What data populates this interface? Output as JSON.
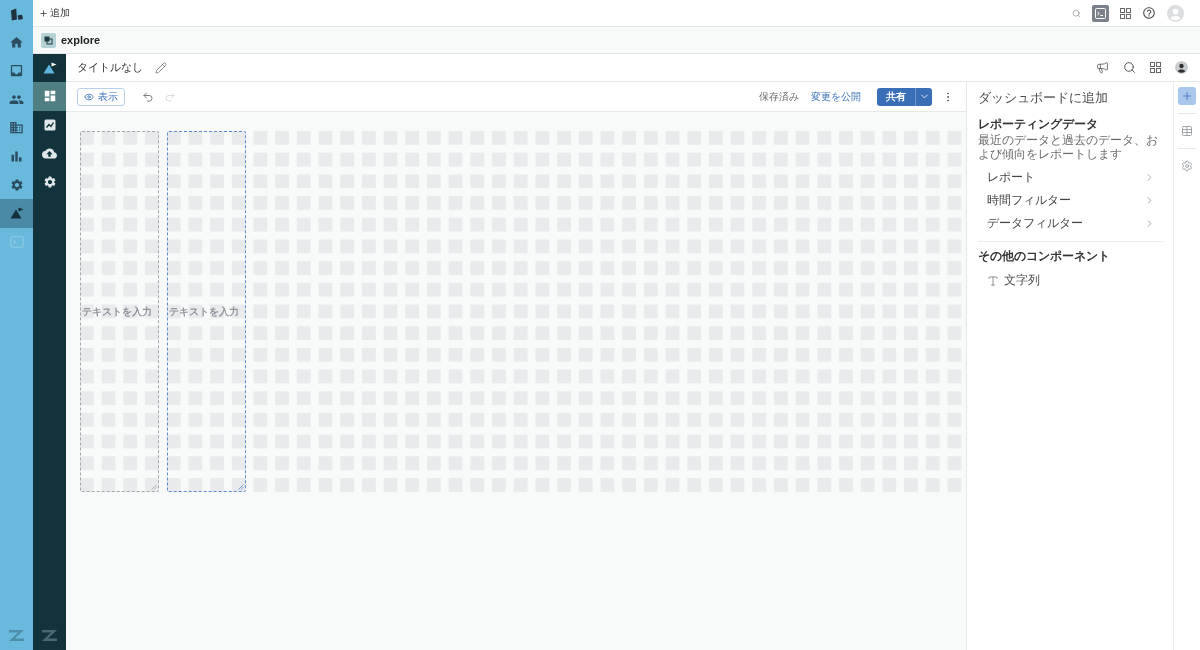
{
  "main_nav": {
    "items": [
      {
        "selected": false,
        "disabled": false
      },
      {
        "selected": false,
        "disabled": false
      },
      {
        "selected": false,
        "disabled": false
      },
      {
        "selected": false,
        "disabled": false
      },
      {
        "selected": false,
        "disabled": false
      },
      {
        "selected": false,
        "disabled": false
      },
      {
        "selected": true,
        "disabled": false
      },
      {
        "selected": false,
        "disabled": true
      }
    ]
  },
  "top_bar": {
    "add_button": "追加"
  },
  "app_header": {
    "name": "explore"
  },
  "explore_nav": {
    "items": [
      {
        "selected": true
      },
      {
        "selected": false
      },
      {
        "selected": false
      },
      {
        "selected": false
      }
    ]
  },
  "title_bar": {
    "title": "タイトルなし"
  },
  "toolbar": {
    "view_button": "表示",
    "undo": {
      "disabled": false
    },
    "redo": {
      "disabled": true
    },
    "save_status": "保存済み",
    "publish_link": "変更を公開",
    "share_button": "共有"
  },
  "canvas": {
    "widgets": [
      {
        "placeholder": "テキストを入力",
        "selected": false
      },
      {
        "placeholder": "テキストを入力",
        "selected": true
      }
    ]
  },
  "add_panel": {
    "title": "ダッシュボードに追加",
    "sections": [
      {
        "heading": "レポーティングデータ",
        "description": "最近のデータと過去のデータ、および傾向をレポートします",
        "items": [
          {
            "kind": "submenu",
            "label": "レポート"
          },
          {
            "kind": "submenu",
            "label": "時間フィルター"
          },
          {
            "kind": "submenu",
            "label": "データフィルター"
          }
        ]
      },
      {
        "heading": "その他のコンポーネント",
        "items": [
          {
            "kind": "component",
            "label": "文字列"
          }
        ]
      }
    ]
  },
  "side_tabs": {
    "items": [
      {
        "selected": true
      },
      {
        "selected": false
      },
      {
        "selected": false
      }
    ]
  }
}
